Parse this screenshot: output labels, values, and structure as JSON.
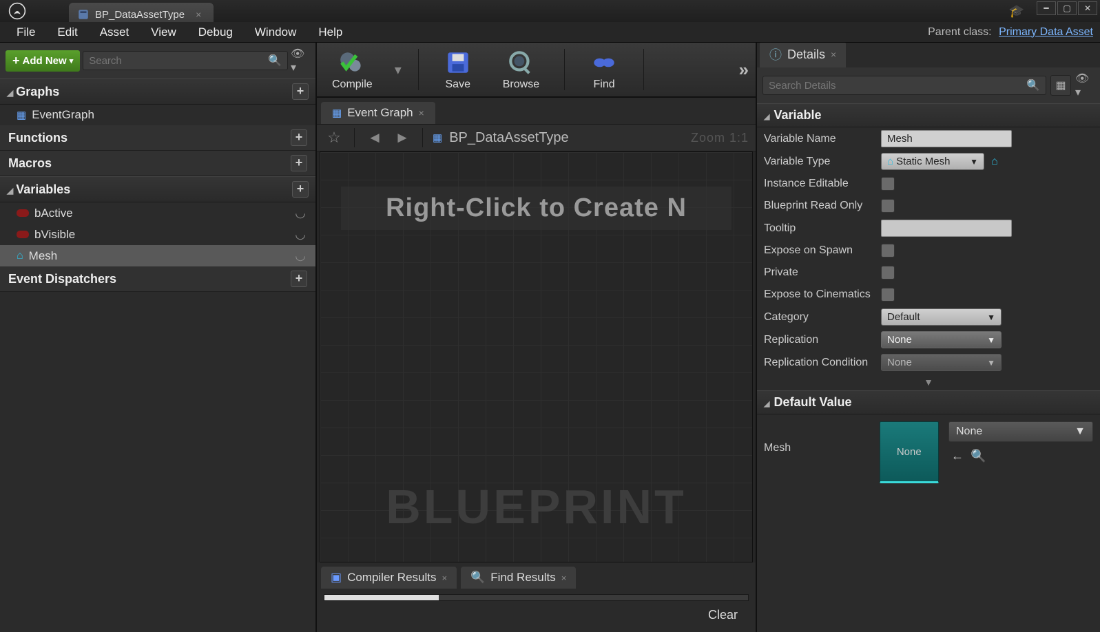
{
  "titlebar": {
    "tab_name": "BP_DataAssetType"
  },
  "menubar": {
    "items": [
      "File",
      "Edit",
      "Asset",
      "View",
      "Debug",
      "Window",
      "Help"
    ],
    "parent_label": "Parent class:",
    "parent_value": "Primary Data Asset"
  },
  "left": {
    "add_new": "Add New",
    "search_placeholder": "Search",
    "sections": {
      "graphs": "Graphs",
      "event_graph": "EventGraph",
      "functions": "Functions",
      "macros": "Macros",
      "variables": "Variables",
      "vars": [
        {
          "name": "bActive",
          "color": "red"
        },
        {
          "name": "bVisible",
          "color": "red"
        },
        {
          "name": "Mesh",
          "icon": "house",
          "selected": true
        }
      ],
      "dispatchers": "Event Dispatchers"
    }
  },
  "toolbar": {
    "compile": "Compile",
    "save": "Save",
    "browse": "Browse",
    "find": "Find"
  },
  "graph": {
    "tab": "Event Graph",
    "breadcrumb": "BP_DataAssetType",
    "zoom": "Zoom 1:1",
    "hint": "Right-Click to Create N",
    "watermark": "BLUEPRINT"
  },
  "bottom": {
    "compiler": "Compiler Results",
    "find": "Find Results",
    "clear": "Clear"
  },
  "details": {
    "tab": "Details",
    "search_placeholder": "Search Details",
    "cat_variable": "Variable",
    "cat_default": "Default Value",
    "rows": {
      "var_name_label": "Variable Name",
      "var_name_value": "Mesh",
      "var_type_label": "Variable Type",
      "var_type_value": "Static Mesh",
      "instance_editable": "Instance Editable",
      "bp_readonly": "Blueprint Read Only",
      "tooltip": "Tooltip",
      "expose_spawn": "Expose on Spawn",
      "private": "Private",
      "expose_cine": "Expose to Cinematics",
      "category_label": "Category",
      "category_value": "Default",
      "replication_label": "Replication",
      "replication_value": "None",
      "repcond_label": "Replication Condition",
      "repcond_value": "None"
    },
    "default_value": {
      "label": "Mesh",
      "thumb_text": "None",
      "dropdown_value": "None"
    }
  }
}
